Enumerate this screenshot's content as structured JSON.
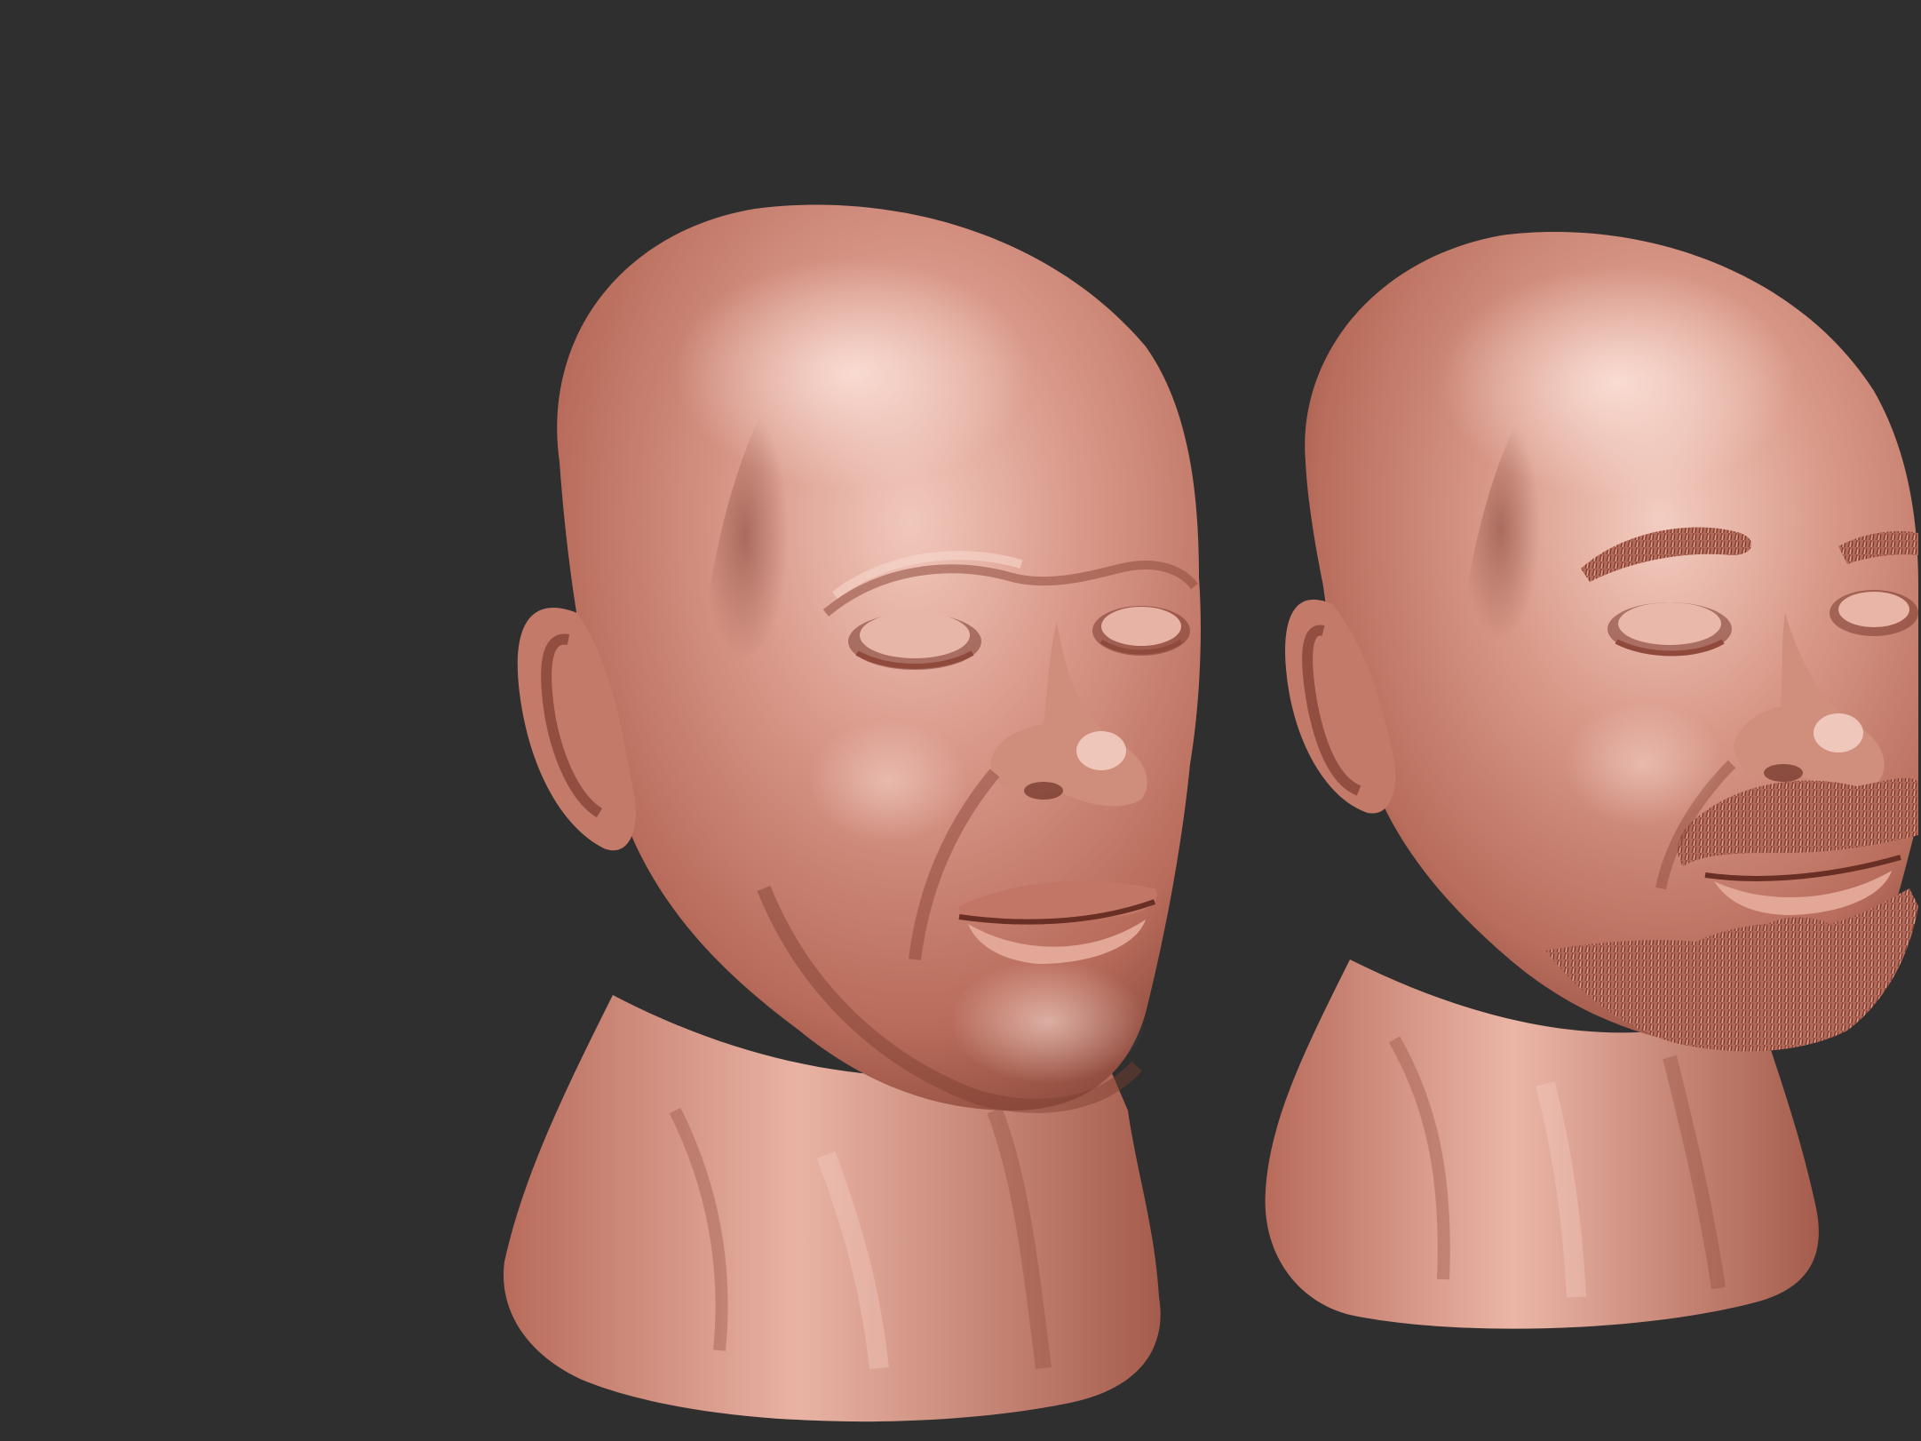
{
  "viewport": {
    "background_color": "#2f2f2f"
  },
  "models": [
    {
      "name": "head-sculpt-base",
      "description_tag": "bald-head-without-beard",
      "material_color": "#c27a68"
    },
    {
      "name": "head-sculpt-detailed",
      "description_tag": "bald-head-with-goatee-beard",
      "material_color": "#c27a68"
    }
  ]
}
